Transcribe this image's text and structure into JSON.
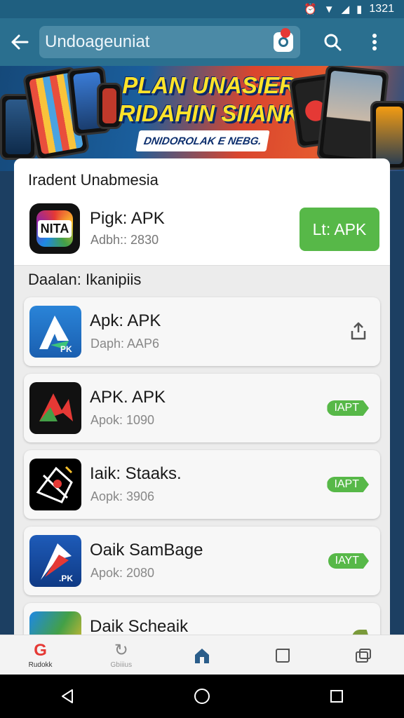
{
  "status": {
    "time": "1321"
  },
  "search": {
    "value": "Undoageuniat"
  },
  "banner": {
    "title_line1": "PLAN UNASIER",
    "title_line2": "RIDAHIN SIIANK",
    "subtitle": "DNIDOROLAK E NEBG."
  },
  "featured": {
    "section_title": "Iradent Unabmesia",
    "app": {
      "name": "Pigk: APK",
      "sub": "Adbh:: 2830",
      "button": "Lt: APK",
      "icon_text": "NITA"
    }
  },
  "list": {
    "section_title": "Daalan: Ikanipiis",
    "items": [
      {
        "name": "Apk: APK",
        "sub": "Daph: AAP6",
        "action": "share-icon"
      },
      {
        "name": "APK. APK",
        "sub": "Apok: 1090",
        "action": "IAPT"
      },
      {
        "name": "Iaik: Staaks.",
        "sub": "Aopk: 3906",
        "action": "IAPT"
      },
      {
        "name": "Oaik SamBage",
        "sub": "Apok: 2080",
        "action": "IAYT"
      },
      {
        "name": "Daik Scheaik",
        "sub": "",
        "action": ""
      }
    ]
  },
  "bottom_nav": {
    "items": [
      {
        "label": "Rudokk",
        "icon": "g-icon"
      },
      {
        "label": "Gbiiius",
        "icon": "refresh-icon"
      },
      {
        "label": "",
        "icon": "home-icon"
      },
      {
        "label": "",
        "icon": "tablet-icon"
      },
      {
        "label": "",
        "icon": "windows-icon"
      }
    ]
  },
  "colors": {
    "accent_green": "#57b848",
    "appbar": "#2a6f8f"
  }
}
